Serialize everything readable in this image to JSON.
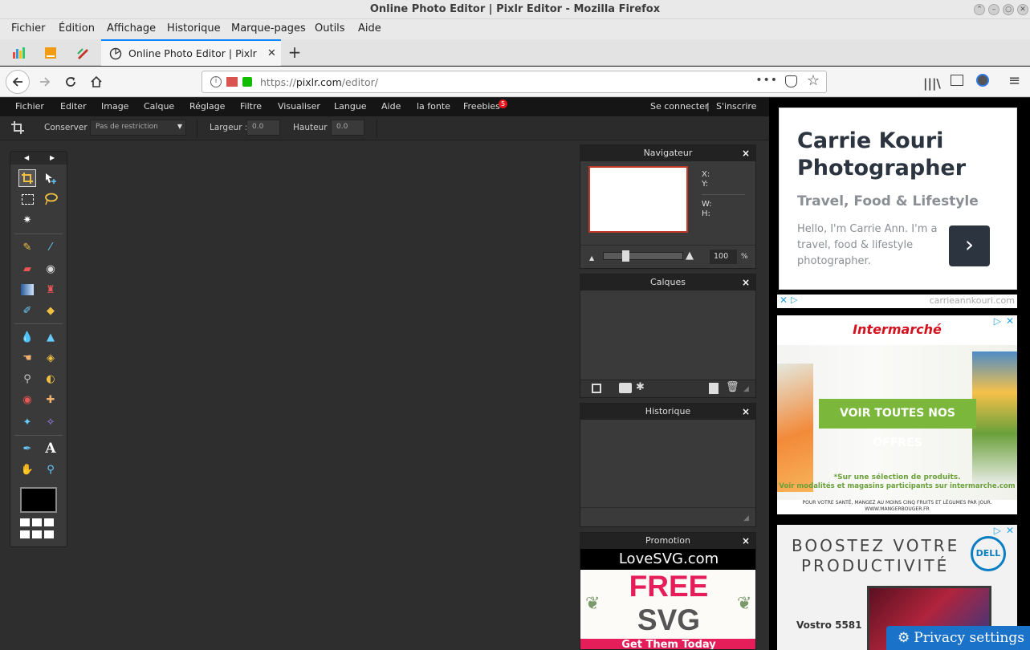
{
  "window": {
    "title": "Online Photo Editor | Pixlr Editor - Mozilla Firefox"
  },
  "firefox_menu": [
    "Fichier",
    "Édition",
    "Affichage",
    "Historique",
    "Marque-pages",
    "Outils",
    "Aide"
  ],
  "tab": {
    "title": "Online Photo Editor | Pixlr Edi"
  },
  "url": {
    "scheme": "https://",
    "host": "pixlr.com",
    "path": "/editor/"
  },
  "pixlr_menu": {
    "items": [
      "Fichier",
      "Editer",
      "Image",
      "Calque",
      "Réglage",
      "Filtre",
      "Visualiser",
      "Langue",
      "Aide",
      "la fonte",
      "Freebies"
    ],
    "freebies_badge": "5",
    "login": "Se connecter",
    "separator": "|",
    "signup": "S'inscrire"
  },
  "options": {
    "keep_label": "Conserver :",
    "keep_value": "Pas de restriction",
    "width_label": "Largeur :",
    "width_value": "0.0",
    "height_label": "Hauteur :",
    "height_value": "0.0"
  },
  "navigator": {
    "title": "Navigateur",
    "x_label": "X:",
    "y_label": "Y:",
    "w_label": "W:",
    "h_label": "H:",
    "zoom": "100",
    "zoom_unit": "%"
  },
  "layers": {
    "title": "Calques"
  },
  "history": {
    "title": "Historique"
  },
  "promotion": {
    "title": "Promotion",
    "brand": "LoveSVG.com",
    "line1": "FREE",
    "line2": "SVG",
    "line3": "Get Them Today"
  },
  "ads": {
    "carrie": {
      "name": "Carrie Kouri Photographer",
      "tagline": "Travel, Food & Lifestyle",
      "body": "Hello, I'm Carrie Ann. I'm a travel, food & lifestyle photographer.",
      "domain": "carrieannkouri.com"
    },
    "intermarche": {
      "brand": "Intermarché",
      "cta": "VOIR TOUTES NOS OFFRES",
      "note1": "*Sur une sélection de produits.",
      "note2": "Voir modalités et magasins participants sur intermarche.com",
      "footer1": "POUR VOTRE SANTÉ, MANGEZ AU MOINS CINQ FRUITS ET LÉGUMES PAR JOUR.",
      "footer2": "WWW.MANGERBOUGER.FR"
    },
    "dell": {
      "headline1": "BOOSTEZ VOTRE",
      "headline2": "PRODUCTIVITÉ",
      "brand": "DELL",
      "product": "Vostro 5581"
    }
  },
  "privacy": {
    "label": "Privacy settings"
  }
}
